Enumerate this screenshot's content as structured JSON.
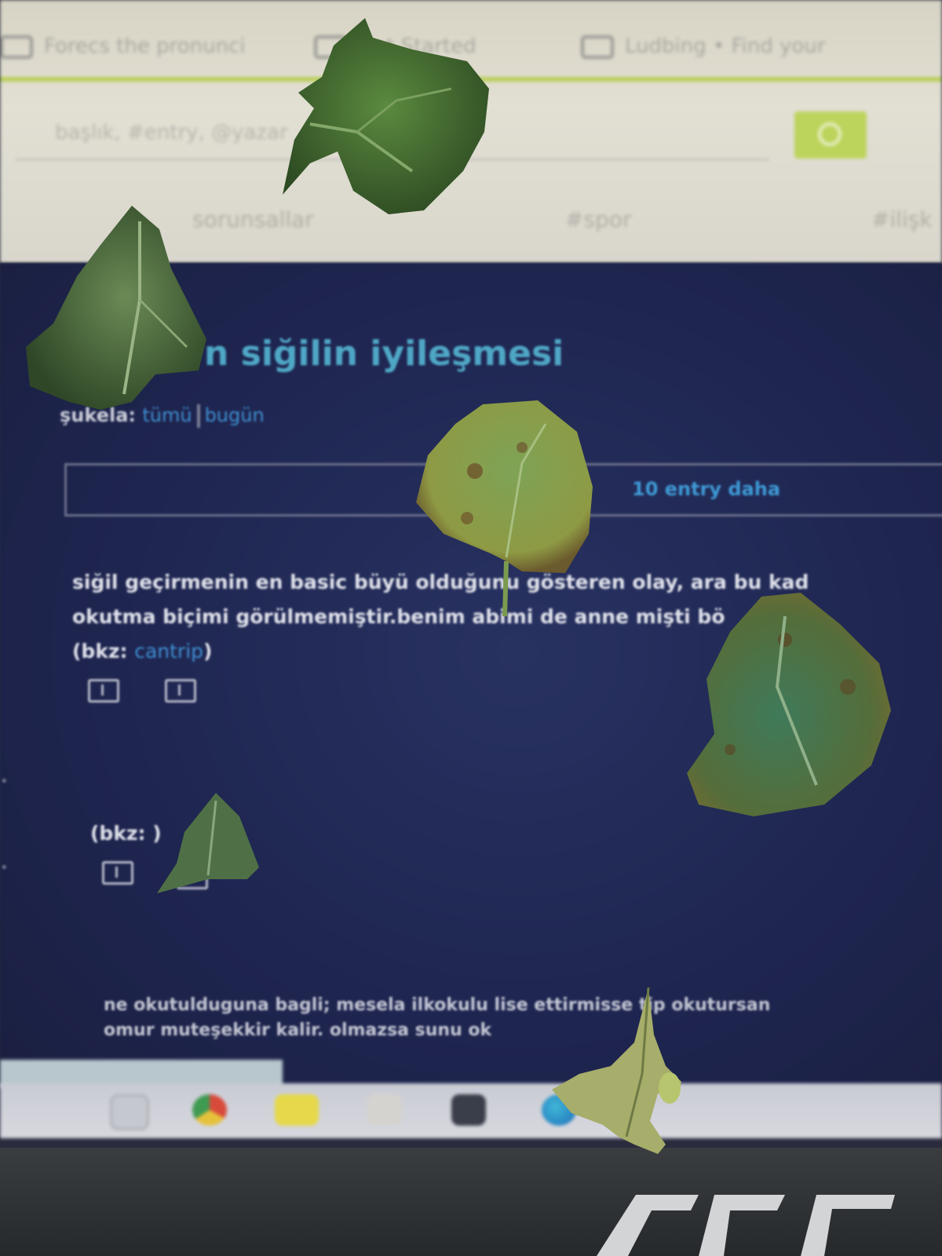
{
  "bookmarks": [
    {
      "label": "Forecs the pronunci"
    },
    {
      "label": "Get Started"
    },
    {
      "label": "Ludbing • Find your"
    }
  ],
  "search": {
    "placeholder": "başlık, #entry, @yazar"
  },
  "nav_tabs": [
    "sorunsallar",
    "#spor",
    "#ilişk"
  ],
  "topic": {
    "title": "n siğilin iyileşmesi"
  },
  "filter": {
    "label": "şukela:",
    "all": "tümü",
    "today": "bugün"
  },
  "more_entries": "10 entry daha",
  "entries": [
    {
      "line1": "siğil geçirmenin en basic büyü olduğunu gösteren olay, ara bu kad",
      "line2": "okutma biçimi görülmemiştir.benim abimi de anne          mişti bö",
      "bkz_prefix": "(bkz: ",
      "bkz_link": "cantrip",
      "bkz_suffix": ")"
    },
    {
      "bkz_prefix": "(bkz: ",
      "bkz_link": "",
      "bkz_suffix": ")"
    },
    {
      "line1": "ne okutulduguna bagli; mesela ilkokulu lise     ettirmisse tip okutursan",
      "line2": "omur muteşekkir kalir. olmazsa sunu ok"
    }
  ],
  "colors": {
    "page_bg_dark": "#1e2550",
    "title_blue": "#4fa7c6",
    "link_blue": "#3f8fd0",
    "accent_green": "#b9cf58",
    "leaf_green": "#4f7a3a",
    "leaf_yellow": "#a8b04a"
  },
  "icons": [
    "bookmark-icon",
    "search-icon",
    "upvote-icon",
    "downvote-icon",
    "chrome-icon",
    "folder-icon",
    "edge-icon",
    "store-icon"
  ]
}
